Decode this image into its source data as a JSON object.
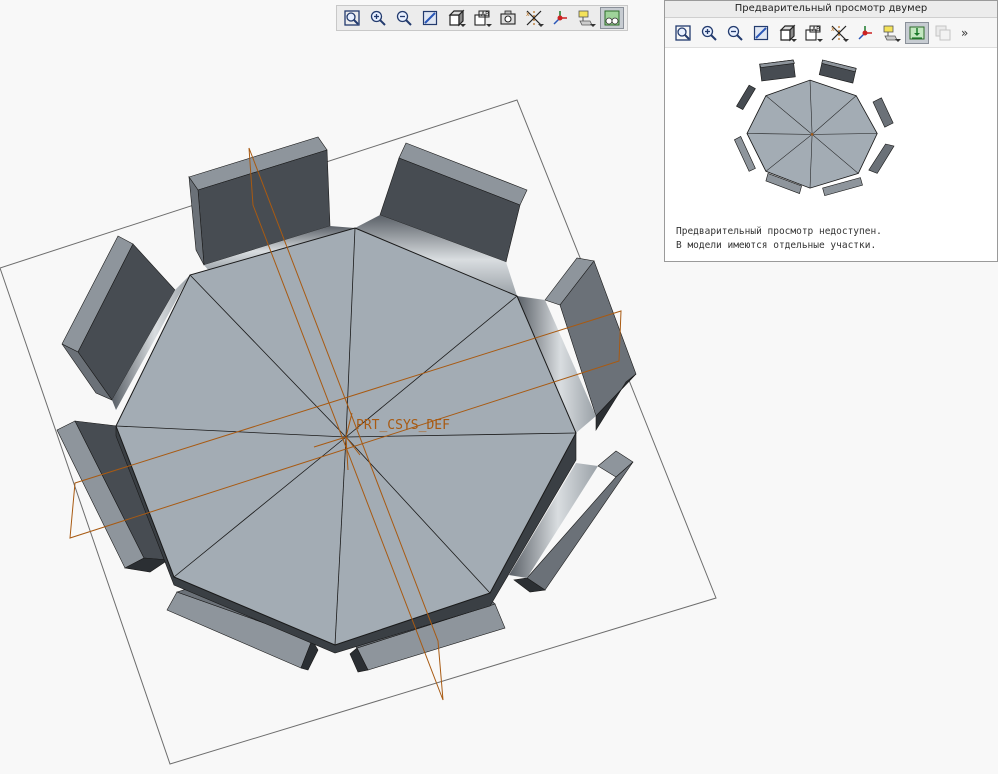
{
  "viewport": {
    "csys_label": "PRT_CSYS_DEF"
  },
  "main_toolbar": {
    "buttons": [
      {
        "name": "refit",
        "icon": "zoom-fit-icon",
        "pressed": false,
        "dropdown": false
      },
      {
        "name": "zoom-in",
        "icon": "zoom-in-icon",
        "pressed": false,
        "dropdown": false
      },
      {
        "name": "zoom-out",
        "icon": "zoom-out-icon",
        "pressed": false,
        "dropdown": false
      },
      {
        "name": "repaint",
        "icon": "repaint-icon",
        "pressed": false,
        "dropdown": false
      },
      {
        "name": "display-style",
        "icon": "display-style-icon",
        "pressed": false,
        "dropdown": true
      },
      {
        "name": "saved-orientations",
        "icon": "saved-views-icon",
        "pressed": false,
        "dropdown": true
      },
      {
        "name": "view-manager",
        "icon": "view-manager-icon",
        "pressed": false,
        "dropdown": false
      },
      {
        "name": "datum-display",
        "icon": "datum-display-icon",
        "pressed": false,
        "dropdown": true
      },
      {
        "name": "spin-center",
        "icon": "spin-center-icon",
        "pressed": false,
        "dropdown": false
      },
      {
        "name": "annotation-display",
        "icon": "annotation-display-icon",
        "pressed": false,
        "dropdown": true
      },
      {
        "name": "appearance-gallery",
        "icon": "appearance-gallery-icon",
        "pressed": true,
        "dropdown": false
      }
    ]
  },
  "preview_panel": {
    "title": "Предварительный просмотр двумер",
    "more": "»",
    "message_line1": "Предварительный просмотр недоступен.",
    "message_line2": "В модели имеются отдельные участки.",
    "buttons": [
      {
        "name": "refit",
        "icon": "zoom-fit-icon",
        "pressed": false,
        "dropdown": false
      },
      {
        "name": "zoom-in",
        "icon": "zoom-in-icon",
        "pressed": false,
        "dropdown": false
      },
      {
        "name": "zoom-out",
        "icon": "zoom-out-icon",
        "pressed": false,
        "dropdown": false
      },
      {
        "name": "repaint",
        "icon": "repaint-icon",
        "pressed": false,
        "dropdown": false
      },
      {
        "name": "display-style",
        "icon": "display-style-icon",
        "pressed": false,
        "dropdown": true
      },
      {
        "name": "saved-orientations",
        "icon": "saved-views-icon",
        "pressed": false,
        "dropdown": true
      },
      {
        "name": "datum-display",
        "icon": "datum-display-icon",
        "pressed": false,
        "dropdown": true
      },
      {
        "name": "spin-center",
        "icon": "spin-center-icon",
        "pressed": false,
        "dropdown": false
      },
      {
        "name": "annotation-display",
        "icon": "annotation-display-icon",
        "pressed": false,
        "dropdown": true
      },
      {
        "name": "preview-fit",
        "icon": "preview-fit-icon",
        "pressed": true,
        "dropdown": false
      },
      {
        "name": "preview-overlay",
        "icon": "preview-overlay-icon",
        "pressed": false,
        "dropdown": false,
        "disabled": true
      }
    ]
  },
  "colors": {
    "background": "#f8f8f8",
    "top_face": "#a3acb4",
    "tab_dark": "#474c52",
    "tab_mid": "#6b7178",
    "tab_light": "#8e959c",
    "datum": "#a85a12",
    "outline": "#1a1a1a"
  }
}
